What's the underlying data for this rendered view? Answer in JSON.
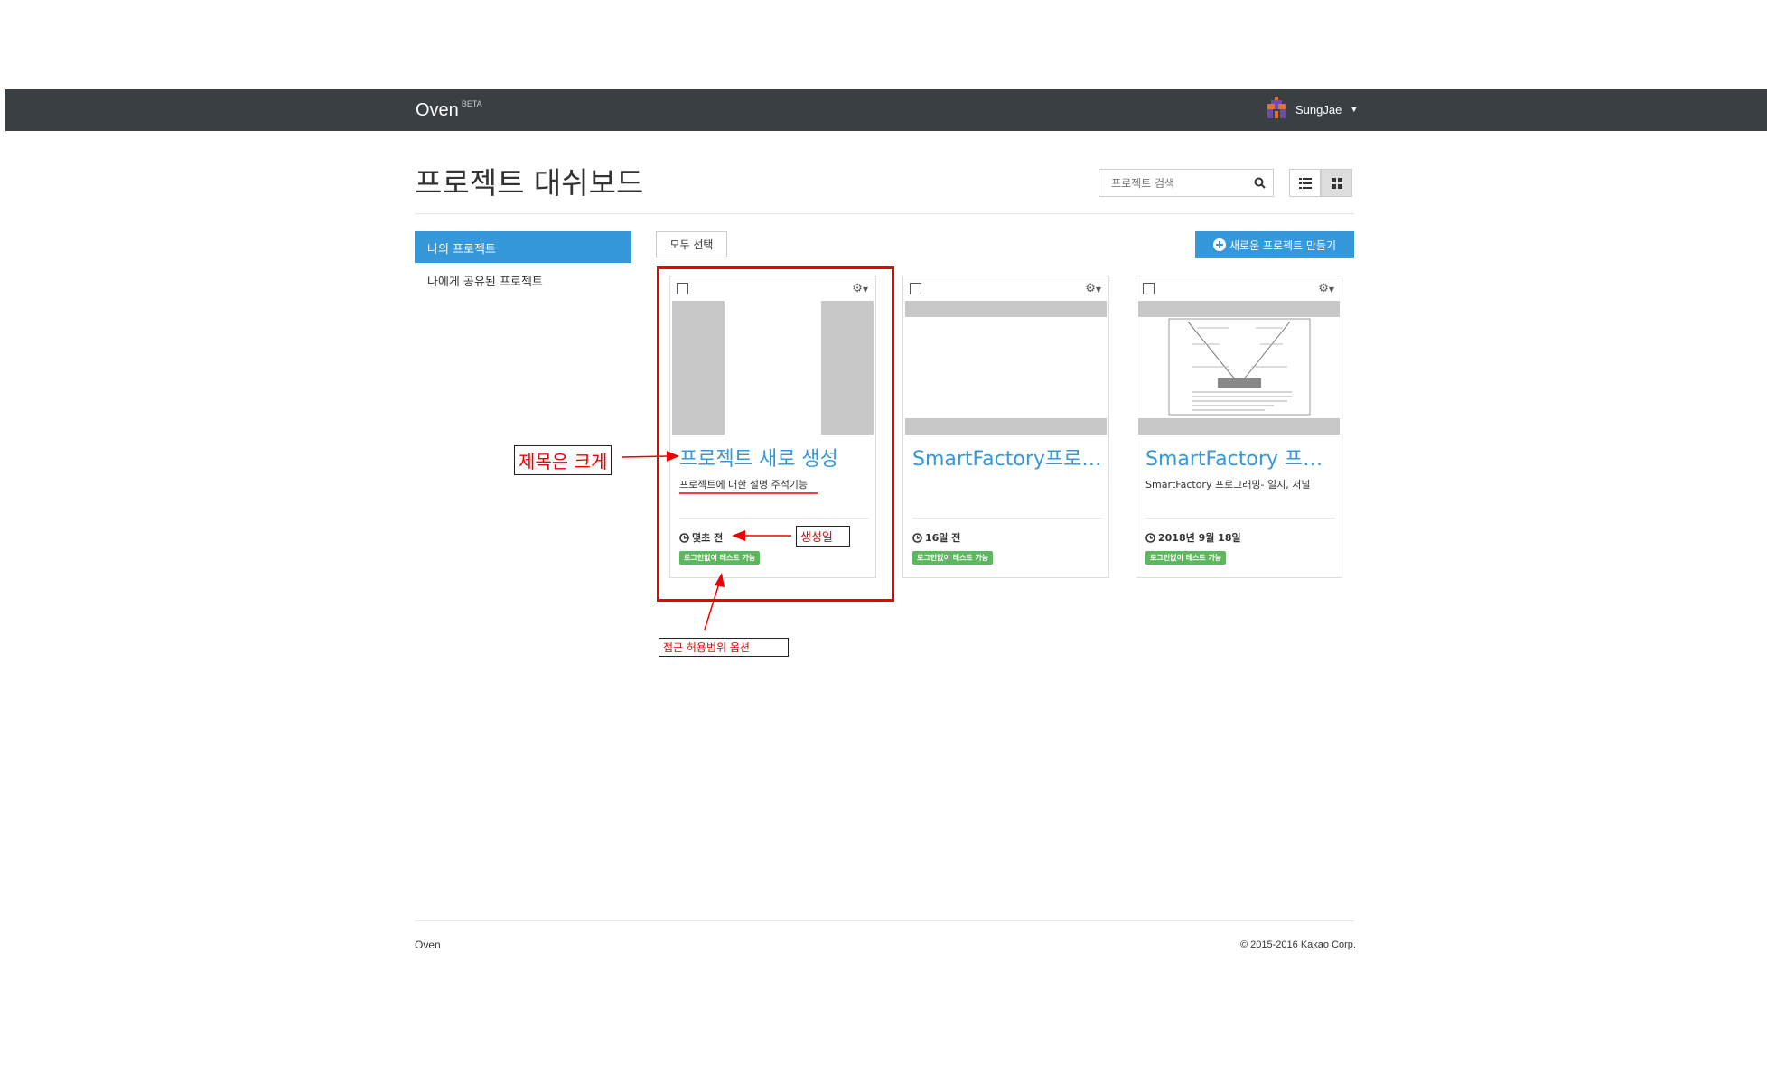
{
  "navbar": {
    "brand": "Oven",
    "brand_badge": "BETA",
    "user_name": "SungJae"
  },
  "header": {
    "title": "프로젝트 대쉬보드",
    "search_placeholder": "프로젝트 검색"
  },
  "sidebar": {
    "items": [
      {
        "label": "나의 프로젝트",
        "active": true
      },
      {
        "label": "나에게 공유된 프로젝트",
        "active": false
      }
    ]
  },
  "toolbar": {
    "select_all_label": "모두 선택",
    "new_project_label": "새로운 프로젝트 만들기"
  },
  "projects": [
    {
      "title": "프로젝트 새로 생성",
      "description": "프로젝트에 대한 설명 주석기능",
      "date": "몇초 전",
      "badge": "로그인없이 테스트 가능"
    },
    {
      "title": "SmartFactory프로젝트",
      "description": "",
      "date": "16일 전",
      "badge": "로그인없이 테스트 가능"
    },
    {
      "title": "SmartFactory 프로젝트",
      "description": "SmartFactory 프로그래밍- 일지, 저널",
      "date": "2018년 9월 18일",
      "badge": "로그인없이 테스트 가능"
    }
  ],
  "annotations": {
    "title_note": "제목은 크게",
    "date_note": "생성일",
    "access_note": "접근 허용범위 옵션"
  },
  "footer": {
    "left": "Oven",
    "right": "© 2015-2016 Kakao Corp."
  },
  "colors": {
    "navbar": "#3a3f44",
    "primary": "#3498db",
    "badge": "#5cb85c",
    "annotation": "#ee0000"
  }
}
